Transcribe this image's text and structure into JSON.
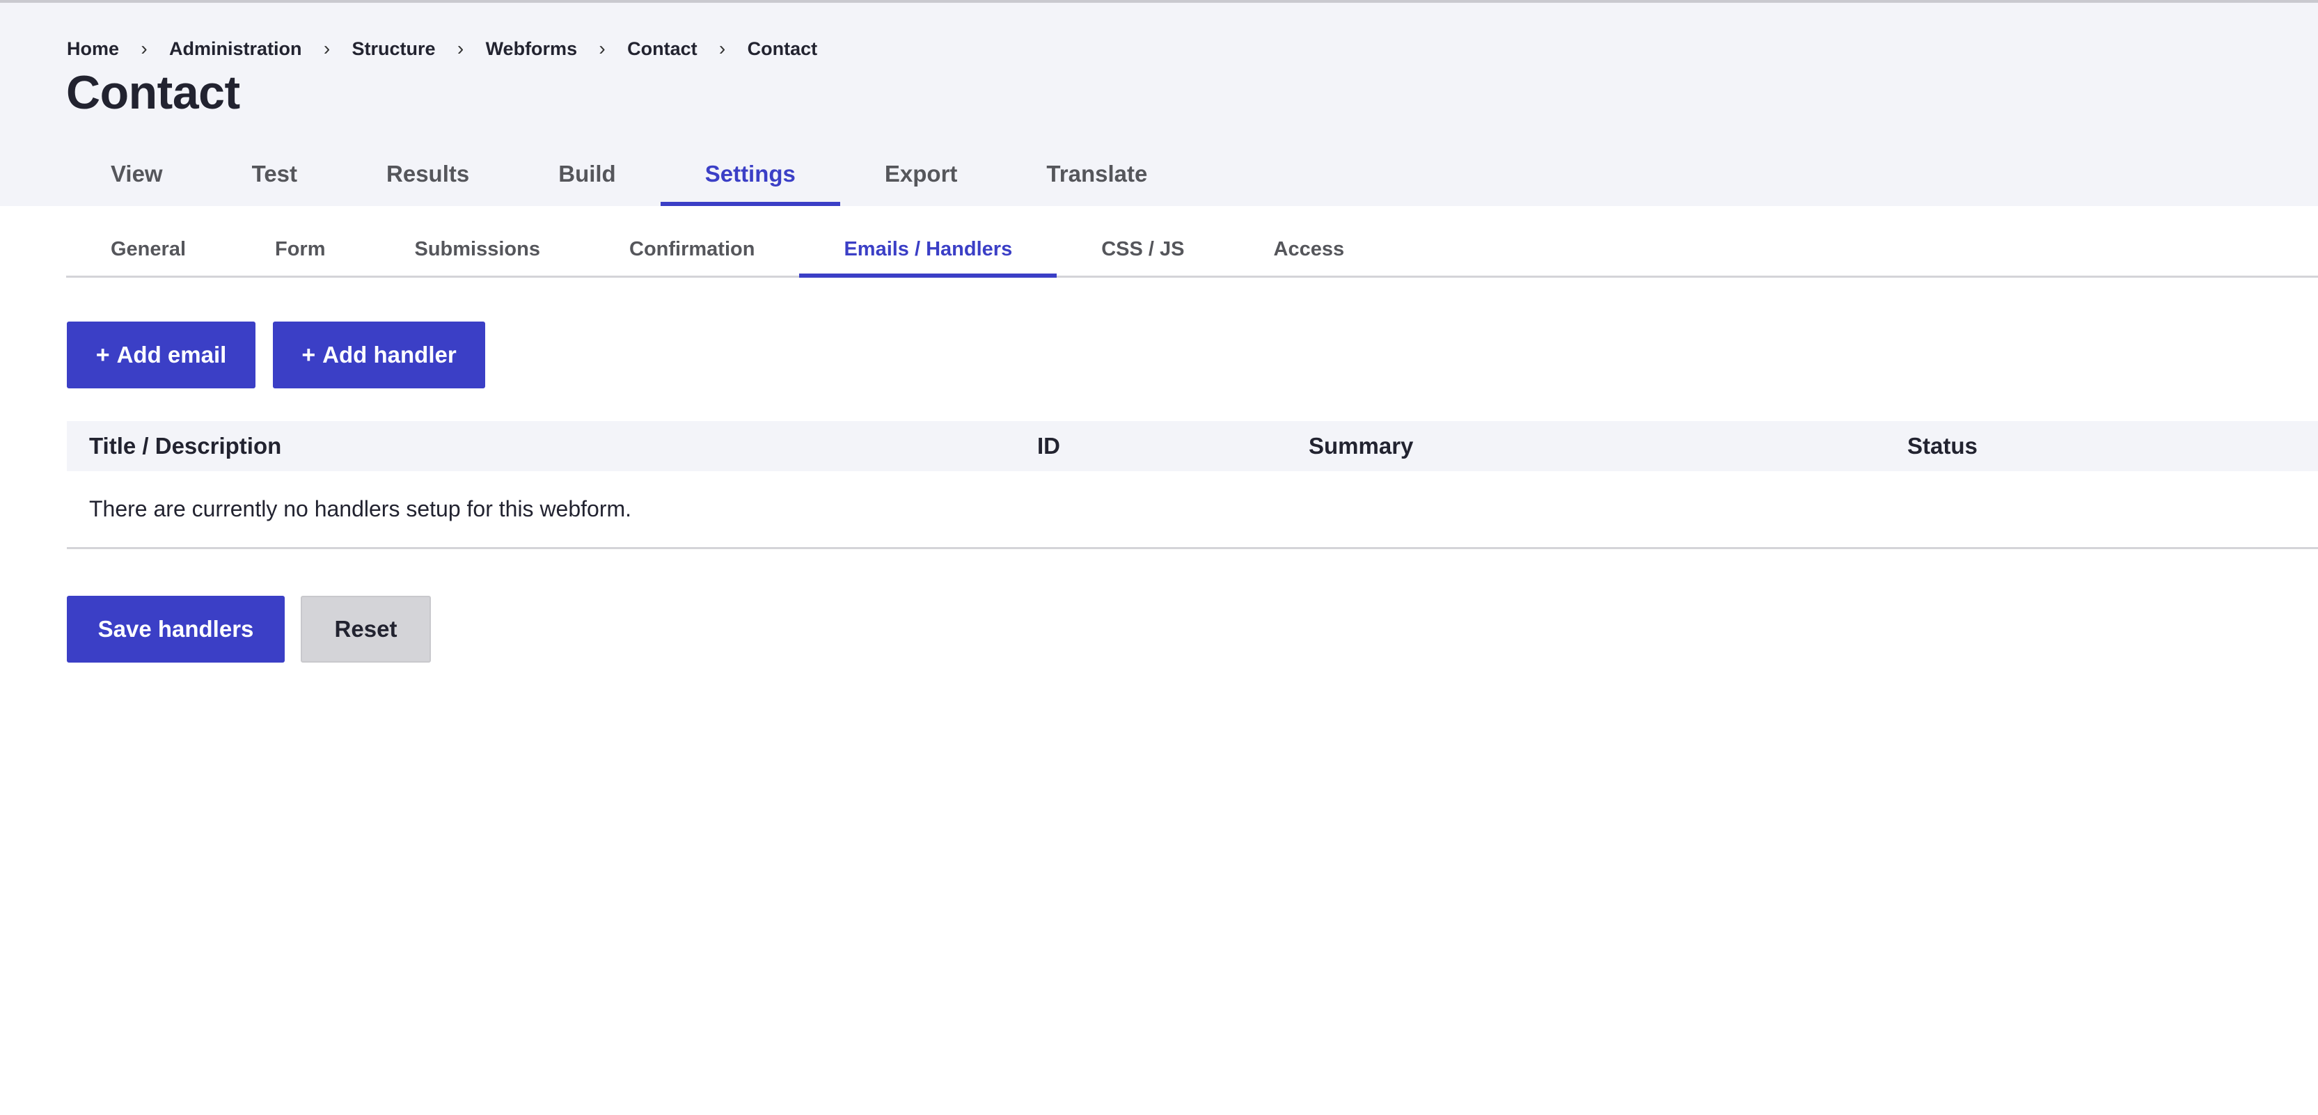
{
  "breadcrumb": [
    "Home",
    "Administration",
    "Structure",
    "Webforms",
    "Contact",
    "Contact"
  ],
  "page_title": "Contact",
  "primary_tabs": [
    {
      "label": "View"
    },
    {
      "label": "Test"
    },
    {
      "label": "Results"
    },
    {
      "label": "Build"
    },
    {
      "label": "Settings",
      "active": true
    },
    {
      "label": "Export"
    },
    {
      "label": "Translate"
    }
  ],
  "secondary_tabs": [
    {
      "label": "General"
    },
    {
      "label": "Form"
    },
    {
      "label": "Submissions"
    },
    {
      "label": "Confirmation"
    },
    {
      "label": "Emails / Handlers",
      "active": true
    },
    {
      "label": "CSS / JS"
    },
    {
      "label": "Access"
    }
  ],
  "actions": {
    "add_email_label": "Add email",
    "add_handler_label": "Add handler",
    "plus_glyph": "+"
  },
  "table": {
    "headers": {
      "title": "Title / Description",
      "id": "ID",
      "summary": "Summary",
      "status": "Status"
    },
    "empty_message": "There are currently no handlers setup for this webform."
  },
  "form_actions": {
    "save_label": "Save handlers",
    "reset_label": "Reset"
  },
  "colors": {
    "accent": "#3b3fc6",
    "header_bg": "#f3f4f9",
    "secondary_button": "#d4d4d8"
  }
}
